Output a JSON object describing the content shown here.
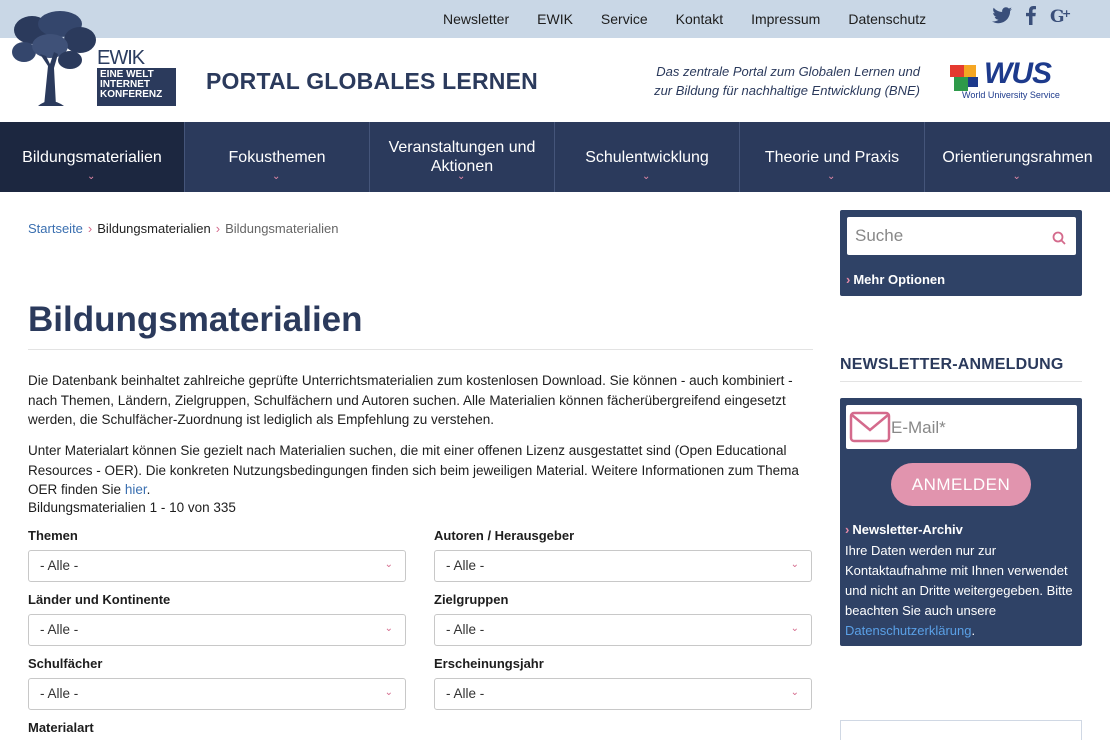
{
  "top_links": [
    "Newsletter",
    "EWIK",
    "Service",
    "Kontakt",
    "Impressum",
    "Datenschutz"
  ],
  "social": {
    "twitter": "twitter-icon",
    "facebook": "facebook-icon",
    "googleplus": "googleplus-icon"
  },
  "logo": {
    "ewik": "EWIK",
    "line1": "EINE WELT",
    "line2": "INTERNET",
    "line3": "KONFERENZ"
  },
  "portal_title": "PORTAL GLOBALES LERNEN",
  "tagline": {
    "line1": "Das zentrale Portal zum Globalen Lernen und",
    "line2": "zur Bildung für nachhaltige Entwicklung (BNE)"
  },
  "wus": {
    "name": "WUS",
    "sub": "World University Service"
  },
  "nav": [
    {
      "label": "Bildungsmaterialien"
    },
    {
      "label": "Fokusthemen"
    },
    {
      "label": "Veranstaltungen und Aktionen"
    },
    {
      "label": "Schulentwicklung"
    },
    {
      "label": "Theorie und Praxis"
    },
    {
      "label": "Orientierungsrahmen"
    }
  ],
  "breadcrumb": [
    "Startseite",
    "Bildungsmaterialien",
    "Bildungsmaterialien"
  ],
  "page_title": "Bildungsmaterialien",
  "paragraph1": "Die Datenbank beinhaltet zahlreiche geprüfte Unterrichtsmaterialien zum kostenlosen Download. Sie können - auch kombiniert - nach Themen, Ländern, Zielgruppen, Schulfächern und Autoren suchen. Alle Materialien können fächerübergreifend eingesetzt werden, die Schulfächer-Zuordnung ist lediglich als Empfehlung zu verstehen.",
  "paragraph2": "Unter Materialart können Sie gezielt nach Materialien suchen, die mit einer offenen Lizenz ausgestattet sind (Open Educational Resources - OER). Die konkreten Nutzungsbedingungen finden sich beim jeweiligen Material. Weitere Informationen zum Thema OER finden Sie",
  "paragraph2_link": "hier",
  "result_count": "Bildungsmaterialien 1 - 10 von 335",
  "filters": [
    {
      "label": "Themen",
      "value": "- Alle -"
    },
    {
      "label": "Autoren / Herausgeber",
      "value": "- Alle -"
    },
    {
      "label": "Länder und Kontinente",
      "value": "- Alle -"
    },
    {
      "label": "Zielgruppen",
      "value": "- Alle -"
    },
    {
      "label": "Schulfächer",
      "value": "- Alle -"
    },
    {
      "label": "Erscheinungsjahr",
      "value": "- Alle -"
    },
    {
      "label": "Materialart",
      "value": ""
    }
  ],
  "sidebar": {
    "search_placeholder": "Suche",
    "more_options": "Mehr Optionen",
    "newsletter_heading": "NEWSLETTER-ANMELDUNG",
    "email_placeholder": "E-Mail*",
    "subscribe_label": "ANMELDEN",
    "archive_label": "Newsletter-Archiv",
    "privacy_text": "Ihre Daten werden nur zur Kontaktaufnahme mit Ihnen verwendet und nicht an Dritte weitergegeben. Bitte beachten Sie auch unsere",
    "privacy_link": "Datenschutzerklärung",
    "privacy_end": "."
  },
  "colors": {
    "navy": "#2b3a5c",
    "pink": "#e194ae",
    "link": "#3a6fb0",
    "topbar": "#c9d7e6"
  }
}
